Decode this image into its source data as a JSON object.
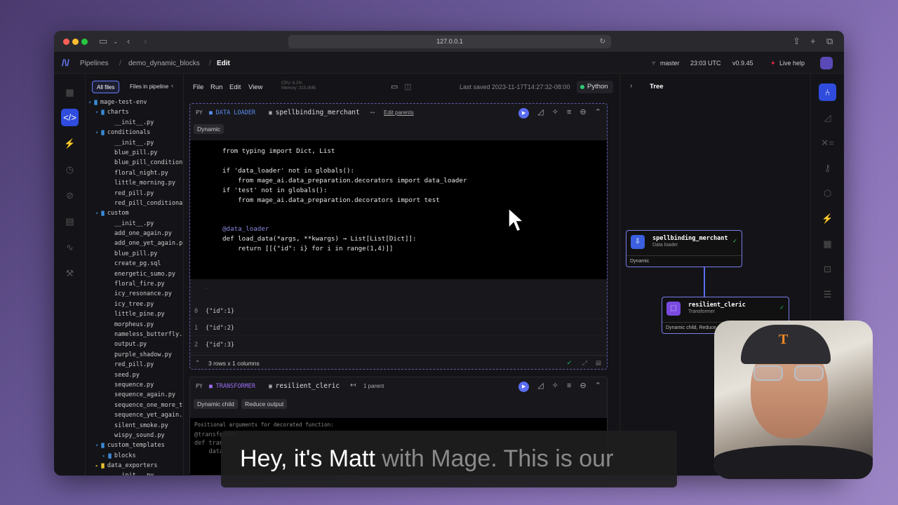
{
  "browser": {
    "url": "127.0.0.1"
  },
  "header": {
    "breadcrumbs": [
      "Pipelines",
      "demo_dynamic_blocks",
      "Edit"
    ],
    "branch": "master",
    "time": "23:03 UTC",
    "version": "v0.9.45",
    "live_help": "Live help"
  },
  "filetree": {
    "tabs": [
      "All files",
      "Files in pipeline"
    ],
    "items": [
      {
        "label": "mage-test-env",
        "level": 0,
        "kind": "root"
      },
      {
        "label": "charts",
        "level": 1,
        "kind": "folder"
      },
      {
        "label": "__init__.py",
        "level": 2,
        "kind": "file"
      },
      {
        "label": "conditionals",
        "level": 1,
        "kind": "folder"
      },
      {
        "label": "__init__.py",
        "level": 2,
        "kind": "file"
      },
      {
        "label": "blue_pill.py",
        "level": 2,
        "kind": "file"
      },
      {
        "label": "blue_pill_condition",
        "level": 2,
        "kind": "file"
      },
      {
        "label": "floral_night.py",
        "level": 2,
        "kind": "file"
      },
      {
        "label": "little_morning.py",
        "level": 2,
        "kind": "file"
      },
      {
        "label": "red_pill.py",
        "level": 2,
        "kind": "file"
      },
      {
        "label": "red_pill_conditiona",
        "level": 2,
        "kind": "file"
      },
      {
        "label": "custom",
        "level": 1,
        "kind": "folder"
      },
      {
        "label": "__init__.py",
        "level": 2,
        "kind": "file"
      },
      {
        "label": "add_one_again.py",
        "level": 2,
        "kind": "file"
      },
      {
        "label": "add_one_yet_again.p",
        "level": 2,
        "kind": "file"
      },
      {
        "label": "blue_pill.py",
        "level": 2,
        "kind": "file"
      },
      {
        "label": "create_pg.sql",
        "level": 2,
        "kind": "file"
      },
      {
        "label": "energetic_sumo.py",
        "level": 2,
        "kind": "file"
      },
      {
        "label": "floral_fire.py",
        "level": 2,
        "kind": "file"
      },
      {
        "label": "icy_resonance.py",
        "level": 2,
        "kind": "file"
      },
      {
        "label": "icy_tree.py",
        "level": 2,
        "kind": "file"
      },
      {
        "label": "little_pine.py",
        "level": 2,
        "kind": "file"
      },
      {
        "label": "morpheus.py",
        "level": 2,
        "kind": "file"
      },
      {
        "label": "nameless_butterfly.",
        "level": 2,
        "kind": "file"
      },
      {
        "label": "output.py",
        "level": 2,
        "kind": "file"
      },
      {
        "label": "purple_shadow.py",
        "level": 2,
        "kind": "file"
      },
      {
        "label": "red_pill.py",
        "level": 2,
        "kind": "file"
      },
      {
        "label": "seed.py",
        "level": 2,
        "kind": "file"
      },
      {
        "label": "sequence.py",
        "level": 2,
        "kind": "file"
      },
      {
        "label": "sequence_again.py",
        "level": 2,
        "kind": "file"
      },
      {
        "label": "sequence_one_more_t",
        "level": 2,
        "kind": "file"
      },
      {
        "label": "sequence_yet_again.",
        "level": 2,
        "kind": "file"
      },
      {
        "label": "silent_smoke.py",
        "level": 2,
        "kind": "file"
      },
      {
        "label": "wispy_sound.py",
        "level": 2,
        "kind": "file"
      },
      {
        "label": "custom_templates",
        "level": 1,
        "kind": "folder"
      },
      {
        "label": "blocks",
        "level": 2,
        "kind": "folder-c"
      },
      {
        "label": "data_exporters",
        "level": 1,
        "kind": "folder-y"
      },
      {
        "label": "__init__.py",
        "level": 2,
        "kind": "file"
      }
    ]
  },
  "editor": {
    "menu": [
      "File",
      "Run",
      "Edit",
      "View"
    ],
    "cpu": "CPU: 6.2%",
    "memory": "Memory: 315.0MB",
    "last_saved": "Last saved 2023-11-17T14:27:32-08:00",
    "kernel": "Python"
  },
  "block1": {
    "lang": "PY",
    "type": "DATA LOADER",
    "name": "spellbinding_merchant",
    "link": "Edit parents",
    "tag": "Dynamic",
    "code": [
      "from typing import Dict, List",
      "",
      "if 'data_loader' not in globals():",
      "    from mage_ai.data_preparation.decorators import data_loader",
      "if 'test' not in globals():",
      "    from mage_ai.data_preparation.decorators import test",
      "",
      "",
      "@data_loader",
      "def load_data(*args, **kwargs) → List[List[Dict]]:",
      "    return [[{\"id\": i} for i in range(1,4)]]"
    ],
    "output_rows": [
      {
        "idx": "0",
        "val": "{\"id\":1}"
      },
      {
        "idx": "1",
        "val": "{\"id\":2}"
      },
      {
        "idx": "2",
        "val": "{\"id\":3}"
      }
    ],
    "output_summary": "3 rows x 1 columns"
  },
  "block2": {
    "lang": "PY",
    "type": "TRANSFORMER",
    "name": "resilient_cleric",
    "parents": "1 parent",
    "tags": [
      "Dynamic child",
      "Reduce output"
    ],
    "args_label": "Positional arguments for decorated function:",
    "code": [
      "@transformer",
      "def tran",
      "    data"
    ]
  },
  "tree": {
    "label": "Tree",
    "nodes": [
      {
        "title": "spellbinding_merchant",
        "sub": "Data loader",
        "foot": "Dynamic"
      },
      {
        "title": "resilient_cleric",
        "sub": "Transformer",
        "foot": "Dynamic child, Reduce output"
      }
    ]
  },
  "caption": {
    "spoken": "Hey, it's Matt",
    "pending": " with Mage. This is our"
  },
  "colors": {
    "accent": "#5a6cf0",
    "loader": "#5a7cf0",
    "transformer": "#8a5cf0",
    "success": "#2ecc71"
  }
}
